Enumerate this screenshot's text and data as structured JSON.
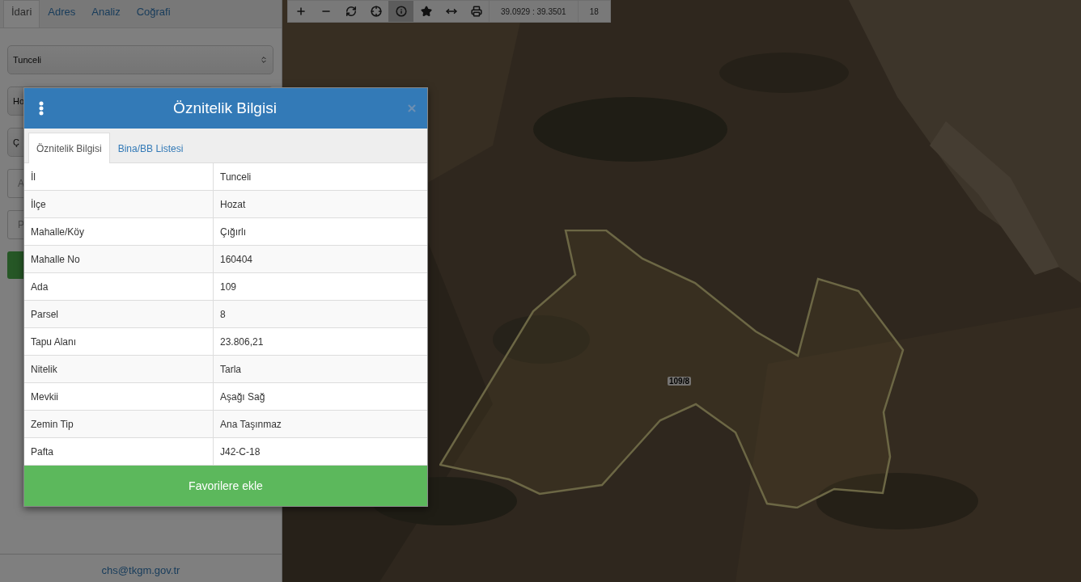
{
  "sidebar": {
    "tabs": [
      {
        "label": "İdari",
        "selected": true
      },
      {
        "label": "Adres",
        "selected": false
      },
      {
        "label": "Analiz",
        "selected": false
      },
      {
        "label": "Coğrafi",
        "selected": false
      }
    ],
    "fields": [
      {
        "kind": "select",
        "value": "Tunceli",
        "arrow": true
      },
      {
        "kind": "select",
        "value": "Ho"
      },
      {
        "kind": "select",
        "value": "Ç"
      },
      {
        "kind": "input",
        "placeholder": "A"
      },
      {
        "kind": "input",
        "placeholder": "P"
      },
      {
        "kind": "button"
      }
    ],
    "footer_link": "chs@tkgm.gov.tr"
  },
  "map_toolbar": {
    "tools": [
      {
        "selected": false
      },
      {
        "selected": false
      },
      {
        "selected": false
      },
      {
        "selected": false
      },
      {
        "selected": true
      },
      {
        "selected": false
      },
      {
        "selected": false
      },
      {
        "selected": false
      }
    ],
    "coordinates": "39.0929 : 39.3501",
    "zoom": "18"
  },
  "map": {
    "kind": "picture",
    "parcel_label": "109/8"
  },
  "dialog": {
    "title": "Öznitelik Bilgisi",
    "tabs": [
      {
        "label": "Öznitelik Bilgisi",
        "selected": true
      },
      {
        "label": "Bina/BB Listesi",
        "selected": false
      }
    ],
    "rows": [
      {
        "label": "İl",
        "value": "Tunceli"
      },
      {
        "label": "İlçe",
        "value": "Hozat"
      },
      {
        "label": "Mahalle/Köy",
        "value": "Çığırlı"
      },
      {
        "label": "Mahalle No",
        "value": "160404"
      },
      {
        "label": "Ada",
        "value": "109"
      },
      {
        "label": "Parsel",
        "value": "8"
      },
      {
        "label": "Tapu Alanı",
        "value": "23.806,21"
      },
      {
        "label": "Nitelik",
        "value": "Tarla"
      },
      {
        "label": "Mevkii",
        "value": "Aşağı Sağ"
      },
      {
        "label": "Zemin Tip",
        "value": "Ana Taşınmaz"
      },
      {
        "label": "Pafta",
        "value": "J42-C-18"
      }
    ],
    "button": "Favorilere ekle"
  }
}
